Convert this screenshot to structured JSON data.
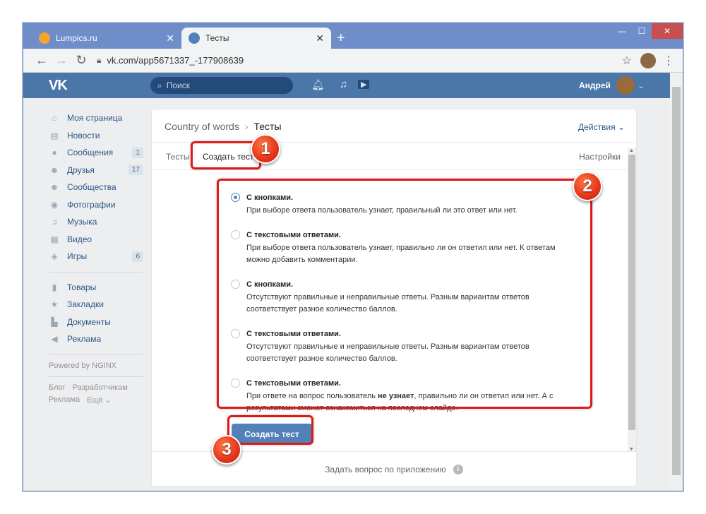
{
  "browser": {
    "tabs": [
      {
        "label": "Lumpics.ru",
        "active": false
      },
      {
        "label": "Тесты",
        "active": true
      }
    ],
    "url": "vk.com/app5671337_-177908639"
  },
  "vk": {
    "logo": "VK",
    "search_placeholder": "Поиск",
    "user_name": "Андрей"
  },
  "sidebar": {
    "items": [
      {
        "label": "Моя страница",
        "icon": "home-icon"
      },
      {
        "label": "Новости",
        "icon": "news-icon"
      },
      {
        "label": "Сообщения",
        "icon": "messages-icon",
        "badge": "1"
      },
      {
        "label": "Друзья",
        "icon": "friends-icon",
        "badge": "17"
      },
      {
        "label": "Сообщества",
        "icon": "communities-icon"
      },
      {
        "label": "Фотографии",
        "icon": "photos-icon"
      },
      {
        "label": "Музыка",
        "icon": "music-icon"
      },
      {
        "label": "Видео",
        "icon": "video-icon"
      },
      {
        "label": "Игры",
        "icon": "games-icon",
        "badge": "6"
      }
    ],
    "items2": [
      {
        "label": "Товары",
        "icon": "goods-icon"
      },
      {
        "label": "Закладки",
        "icon": "bookmarks-icon"
      },
      {
        "label": "Документы",
        "icon": "documents-icon"
      },
      {
        "label": "Реклама",
        "icon": "ads-icon"
      }
    ],
    "powered": "Powered by NGINX",
    "footer_links": [
      "Блог",
      "Разработчикам",
      "Реклама",
      "Ещё ⌄"
    ]
  },
  "content": {
    "breadcrumb_parent": "Country of words",
    "breadcrumb_current": "Тесты",
    "actions_label": "Действия ⌄",
    "tabs": [
      "Тесты",
      "Создать тест"
    ],
    "settings_label": "Настройки",
    "options": [
      {
        "title": "С кнопками.",
        "desc": "При выборе ответа пользователь узнает, правильный ли это ответ или нет.",
        "selected": true
      },
      {
        "title": "С текстовыми ответами.",
        "desc": "При выборе ответа пользователь узнает, правильно ли он ответил или нет. К ответам можно добавить комментарии.",
        "selected": false
      },
      {
        "title": "С кнопками.",
        "desc": "Отсутствуют правильные и неправильные ответы. Разным вариантам ответов соответствует разное количество баллов.",
        "selected": false
      },
      {
        "title": "С текстовыми ответами.",
        "desc": "Отсутствуют правильные и неправильные ответы. Разным вариантам ответов соответствует разное количество баллов.",
        "selected": false
      },
      {
        "title": "С текстовыми ответами.",
        "desc_pre": "При ответе на вопрос пользователь",
        "desc_bold": "не узнает",
        "desc_post": ", правильно ли он ответил или нет. А с результатами сможет ознакомиться на последнем слайде.",
        "selected": false
      }
    ],
    "create_button": "Создать тест",
    "footer_text": "Задать вопрос по приложению"
  },
  "annotations": {
    "markers": [
      "1",
      "2",
      "3"
    ],
    "color": "#e01818"
  }
}
